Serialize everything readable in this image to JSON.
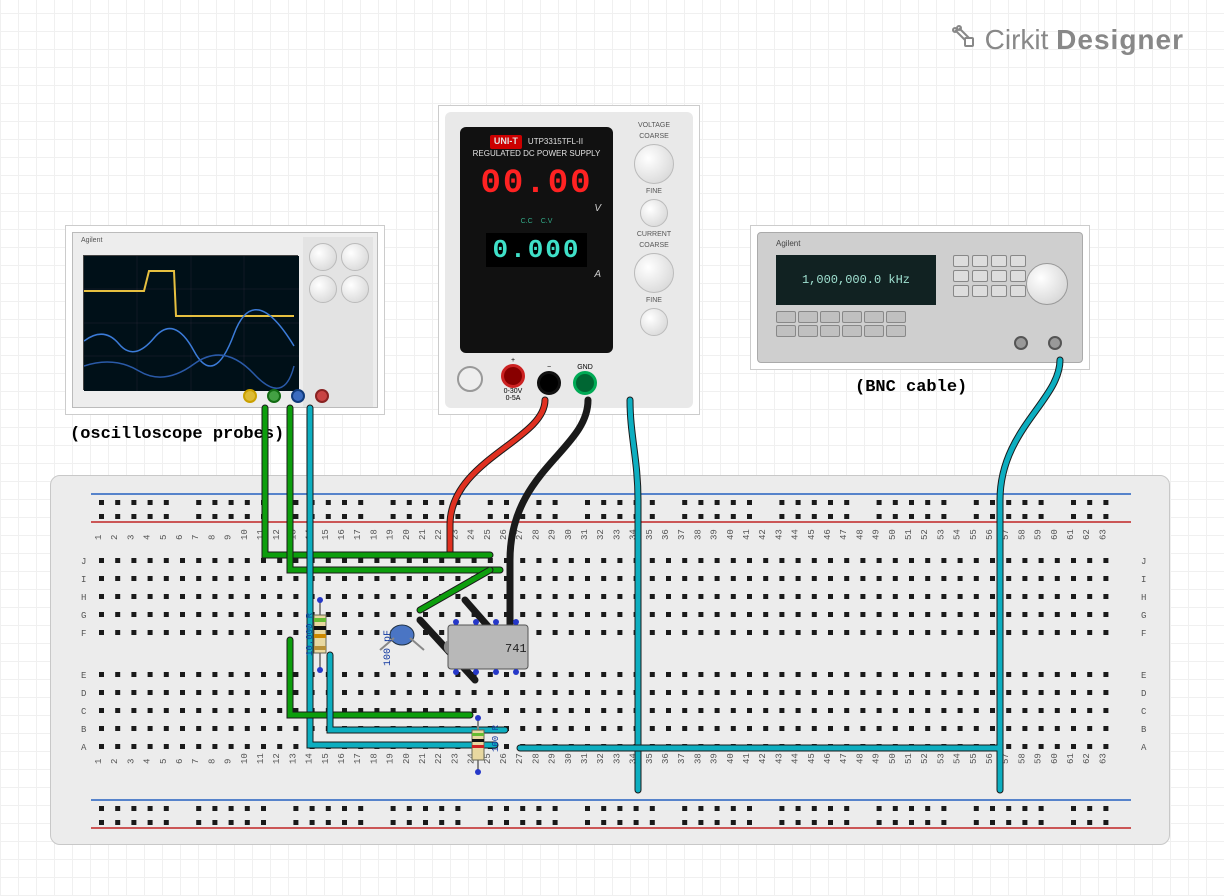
{
  "app": {
    "brand_name": "Cirkit",
    "brand_bold": "Designer"
  },
  "labels": {
    "scope": "(oscilloscope probes)",
    "bnc": "(BNC cable)"
  },
  "psu": {
    "brand": "UNI-T",
    "model": "UTP3315TFL-II",
    "subtitle": "REGULATED DC POWER SUPPLY",
    "voltage_knob_section": "VOLTAGE",
    "current_knob_section": "CURRENT",
    "coarse": "COARSE",
    "fine": "FINE",
    "volt_display": "00.00",
    "volt_unit": "V",
    "amp_display": "0.000",
    "amp_unit": "A",
    "indicator_cc": "C.C",
    "indicator_cv": "C.V",
    "term_pos": "+",
    "term_neg": "−",
    "term_gnd": "GND",
    "term_range": "0-30V\n0-5A"
  },
  "scope": {
    "brand": "Agilent"
  },
  "fg": {
    "brand": "Agilent",
    "display": "1,000,000.0 kHz"
  },
  "breadboard": {
    "row_labels_top": [
      "J",
      "I",
      "H",
      "G",
      "F"
    ],
    "row_labels_bot": [
      "E",
      "D",
      "C",
      "B",
      "A"
    ],
    "col_min": 1,
    "col_max": 63
  },
  "components": {
    "ic_label": "741",
    "cap_label": "100 pF",
    "res1_label": "10.000 R",
    "res2_label": "100 R"
  },
  "wires": [
    {
      "name": "scope-ch1-probe",
      "color": "green"
    },
    {
      "name": "scope-ch2-probe",
      "color": "green"
    },
    {
      "name": "scope-gnd",
      "color": "teal"
    },
    {
      "name": "psu-vplus",
      "color": "red"
    },
    {
      "name": "psu-vminus",
      "color": "black"
    },
    {
      "name": "psu-gnd",
      "color": "teal"
    },
    {
      "name": "fg-bnc-signal",
      "color": "teal"
    },
    {
      "name": "bb-jumper-green-1",
      "color": "green"
    },
    {
      "name": "bb-jumper-green-2",
      "color": "green"
    },
    {
      "name": "bb-jumper-green-3",
      "color": "green"
    },
    {
      "name": "bb-jumper-teal-1",
      "color": "teal"
    },
    {
      "name": "bb-jumper-black-1",
      "color": "black"
    }
  ]
}
